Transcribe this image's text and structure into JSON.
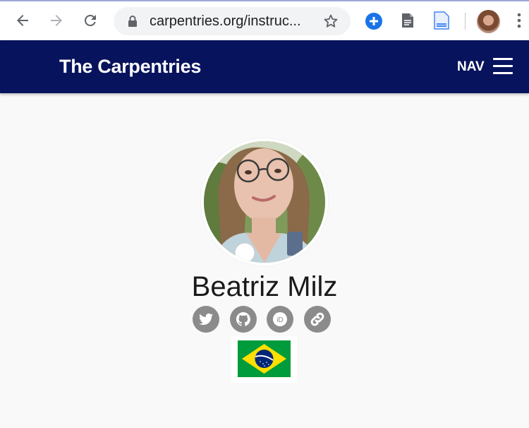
{
  "browser": {
    "url": "carpentries.org/instruc...",
    "icons": [
      "back-arrow-icon",
      "forward-arrow-icon",
      "reload-icon",
      "lock-icon",
      "star-icon",
      "add-extension-icon",
      "document-icon",
      "doc-extension-icon",
      "profile-avatar",
      "more-menu-icon"
    ]
  },
  "site": {
    "brand": "The Carpentries",
    "nav_label": "NAV",
    "nav_icon": "hamburger-menu-icon",
    "header_color": "#07135c"
  },
  "profile": {
    "name": "Beatriz Milz",
    "social_links": [
      "twitter-icon",
      "github-icon",
      "orcid-icon",
      "link-icon"
    ],
    "country_flag": "brazil-flag"
  }
}
